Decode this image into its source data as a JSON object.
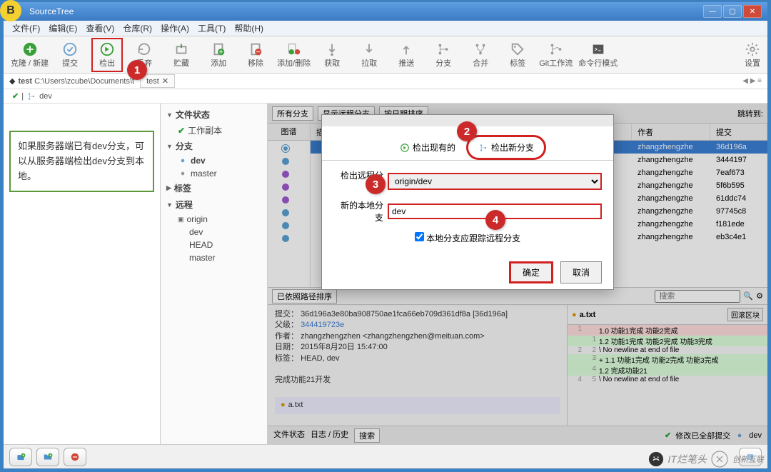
{
  "window": {
    "title": "SourceTree"
  },
  "menu": {
    "file": "文件(F)",
    "edit": "编辑(E)",
    "view": "查看(V)",
    "repo": "仓库(R)",
    "action": "操作(A)",
    "tool": "工具(T)",
    "help": "帮助(H)"
  },
  "toolbar": {
    "clone": "克隆 / 新建",
    "commit": "提交",
    "checkout": "检出",
    "discard": "丢弃",
    "stash": "贮藏",
    "add": "添加",
    "remove": "移除",
    "addremove": "添加/删除",
    "fetch": "获取",
    "pull": "拉取",
    "push": "推送",
    "branch": "分支",
    "merge": "合并",
    "tag": "标签",
    "gitflow": "Git工作流",
    "terminal": "命令行模式",
    "settings": "设置"
  },
  "pathbar": {
    "repo": "test",
    "path": "C:\\Users\\zcube\\Documents\\t",
    "tab": "test",
    "branch": "dev"
  },
  "tree": {
    "filestate": "文件状态",
    "workcopy": "工作副本",
    "branches": "分支",
    "dev": "dev",
    "master": "master",
    "tags": "标签",
    "remotes": "远程",
    "origin": "origin",
    "head": "HEAD"
  },
  "note": "如果服务器端已有dev分支，可以从服务器端检出dev分支到本地。",
  "graph": {
    "filter1": "所有分支",
    "filter2": "显示远程分支",
    "filter3": "按日期排序",
    "jump": "跳转到:",
    "col_graph": "图谱",
    "col_desc": "描述",
    "col_author": "作者",
    "col_commit": "提交",
    "rows": [
      {
        "author": "zhangzhengzhe",
        "hash": "36d196a",
        "selected": true
      },
      {
        "author": "zhangzhengzhe",
        "hash": "3444197"
      },
      {
        "author": "zhangzhengzhe",
        "hash": "7eaf673"
      },
      {
        "author": "zhangzhengzhe",
        "hash": "5f6b595"
      },
      {
        "author": "zhangzhengzhe",
        "hash": "61ddc74"
      },
      {
        "author": "zhangzhengzhe",
        "hash": "97745c8"
      },
      {
        "author": "zhangzhengzhe",
        "hash": "f181ede"
      },
      {
        "author": "zhangzhengzhe",
        "hash": "eb3c4e1"
      }
    ]
  },
  "detail": {
    "sort": "已依照路径排序",
    "commit_label": "提交：",
    "commit": "36d196a3e80ba908750ae1fca66eb709d361df8a [36d196a]",
    "parent_label": "父级：",
    "parent": "344419723e",
    "author_label": "作者：",
    "author": "zhangzhengzhen <zhangzhengzhen@meituan.com>",
    "date_label": "日期：",
    "date": "2015年8月20日 15:47:00",
    "tag_label": "标签：",
    "tag": "HEAD, dev",
    "message": "完成功能21开发",
    "file": "a.txt",
    "search_ph": "搜索",
    "scroll_block": "回滚区块",
    "diff": [
      {
        "l": "1",
        "r": "",
        "t": "del",
        "text": "1.0 功能1完成 功能2完成"
      },
      {
        "l": "",
        "r": "1",
        "t": "add",
        "text": "1.2 功能1完成 功能2完成 功能3完成"
      },
      {
        "l": "2",
        "r": "2",
        "t": "",
        "text": "\\ No newline at end of file"
      },
      {
        "l": "",
        "r": "3",
        "t": "add",
        "text": "+ 1.1 功能1完成 功能2完成 功能3完成"
      },
      {
        "l": "",
        "r": "4",
        "t": "add",
        "text": "1.2 完成功能21"
      },
      {
        "l": "4",
        "r": "5",
        "t": "",
        "text": "\\ No newline at end of file"
      }
    ]
  },
  "tabs": {
    "filestate": "文件状态",
    "log": "日志 / 历史",
    "search": "搜索",
    "status": "修改已全部提交",
    "dev": "dev"
  },
  "dialog": {
    "tab_existing": "检出现有的",
    "tab_new": "检出新分支",
    "remote_label": "检出远程分支",
    "remote_value": "origin/dev",
    "local_label": "新的本地分支",
    "local_value": "dev",
    "track": "本地分支应跟踪远程分支",
    "ok": "确定",
    "cancel": "取消"
  },
  "callouts": {
    "b": "B",
    "c1": "1",
    "c2": "2",
    "c3": "3",
    "c4": "4"
  },
  "watermark": {
    "text": "IT烂笔头",
    "brand": "创新互联"
  }
}
